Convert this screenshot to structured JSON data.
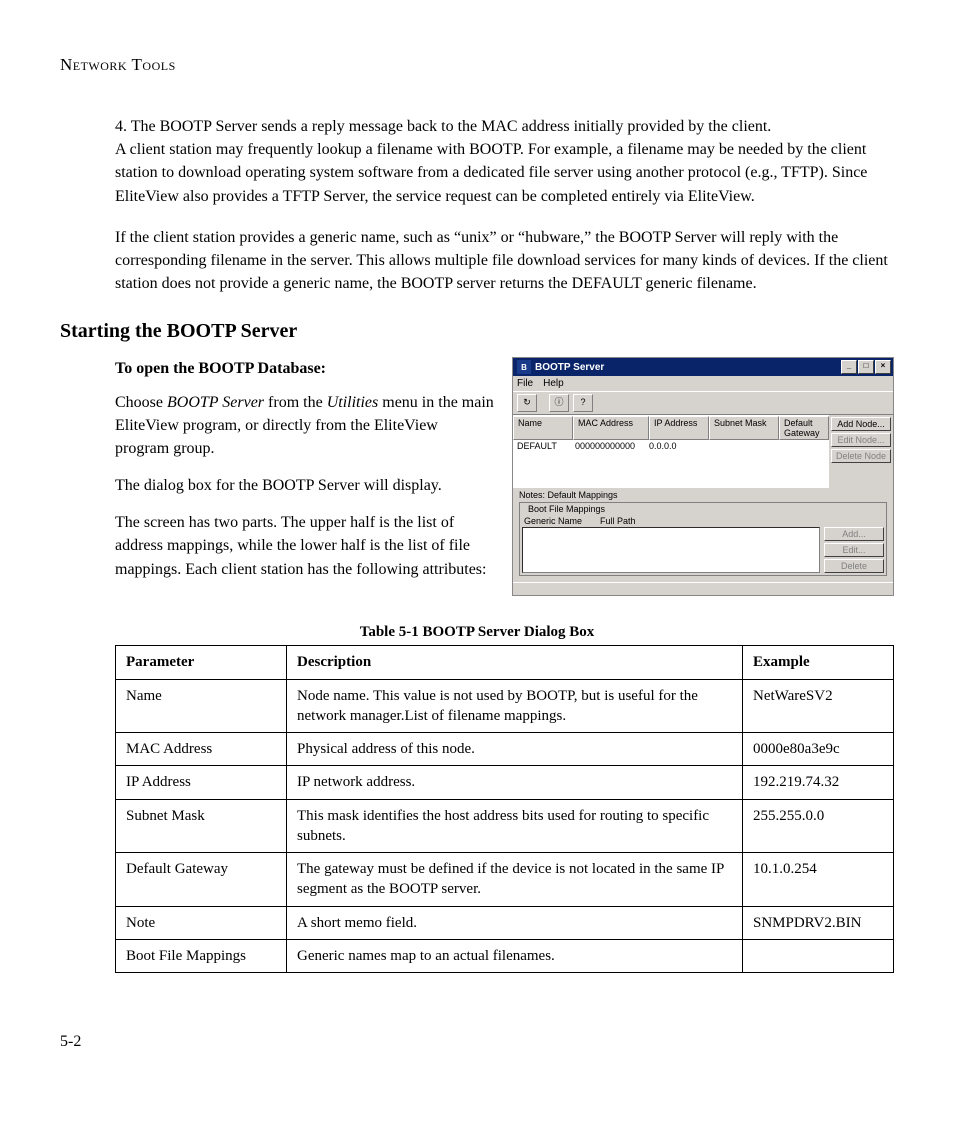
{
  "section_header": "Network Tools",
  "step4": "4.   The BOOTP Server sends a reply message back to the MAC address initially provided by the client.",
  "para1": "A client station may frequently lookup a filename with BOOTP. For example, a filename may be needed by the client station to download operating system software from a dedicated file server using another protocol (e.g., TFTP). Since EliteView also provides a TFTP Server, the service request can be completed entirely via EliteView.",
  "para2": "If the client station provides a generic name, such as “unix” or “hubware,” the BOOTP Server will reply with the corresponding filename in the server. This allows multiple file download services for many kinds of devices. If the client station does not provide a generic name, the BOOTP server returns the DEFAULT generic filename.",
  "heading": "Starting the BOOTP Server",
  "sub_bold": "To open the BOOTP Database:",
  "left_p1_a": "Choose ",
  "left_p1_b": "BOOTP Server",
  "left_p1_c": " from the ",
  "left_p1_d": "Utilities",
  "left_p1_e": " menu in the main EliteView program, or directly from the EliteView program group.",
  "left_p2": "The dialog box for the BOOTP Server will display.",
  "left_p3": "The screen has two parts. The upper half is the list of address mappings, while the lower half is the list of file mappings. Each client station has the following attributes:",
  "screenshot": {
    "title": "BOOTP Server",
    "min": "_",
    "max": "□",
    "close": "×",
    "menu_file": "File",
    "menu_help": "Help",
    "tool_refresh": "↻",
    "tool_info": "ⓘ",
    "tool_help": "?",
    "col_name": "Name",
    "col_mac": "MAC Address",
    "col_ip": "IP Address",
    "col_subnet": "Subnet Mask",
    "col_gw": "Default Gateway",
    "row_name": "DEFAULT",
    "row_mac": "000000000000",
    "row_ip": "0.0.0.0",
    "btn_add_node": "Add Node...",
    "btn_edit_node": "Edit Node...",
    "btn_del_node": "Delete Node",
    "notes": "Notes: Default Mappings",
    "fieldset": "Boot File Mappings",
    "mini_generic": "Generic Name",
    "mini_path": "Full Path",
    "btn_add": "Add...",
    "btn_edit": "Edit...",
    "btn_delete": "Delete"
  },
  "table_caption": "Table 5-1  BOOTP Server Dialog Box",
  "table": {
    "h1": "Parameter",
    "h2": "Description",
    "h3": "Example",
    "rows": [
      {
        "p": "Name",
        "d": "Node name. This value is not used by BOOTP, but is useful for the network manager.List of filename mappings.",
        "e": "NetWareSV2"
      },
      {
        "p": "MAC Address",
        "d": "Physical address of this node.",
        "e": "0000e80a3e9c"
      },
      {
        "p": "IP Address",
        "d": "IP network address.",
        "e": "192.219.74.32"
      },
      {
        "p": "Subnet Mask",
        "d": "This mask identifies the host address bits used for routing to specific subnets.",
        "e": "255.255.0.0"
      },
      {
        "p": "Default Gateway",
        "d": "The gateway must be defined if the device is not located in the same IP segment as the BOOTP server.",
        "e": "10.1.0.254"
      },
      {
        "p": "Note",
        "d": "A short memo field.",
        "e": "SNMPDRV2.BIN"
      },
      {
        "p": "Boot File Mappings",
        "d": "Generic names map to an actual filenames.",
        "e": ""
      }
    ]
  },
  "page_number": "5-2"
}
